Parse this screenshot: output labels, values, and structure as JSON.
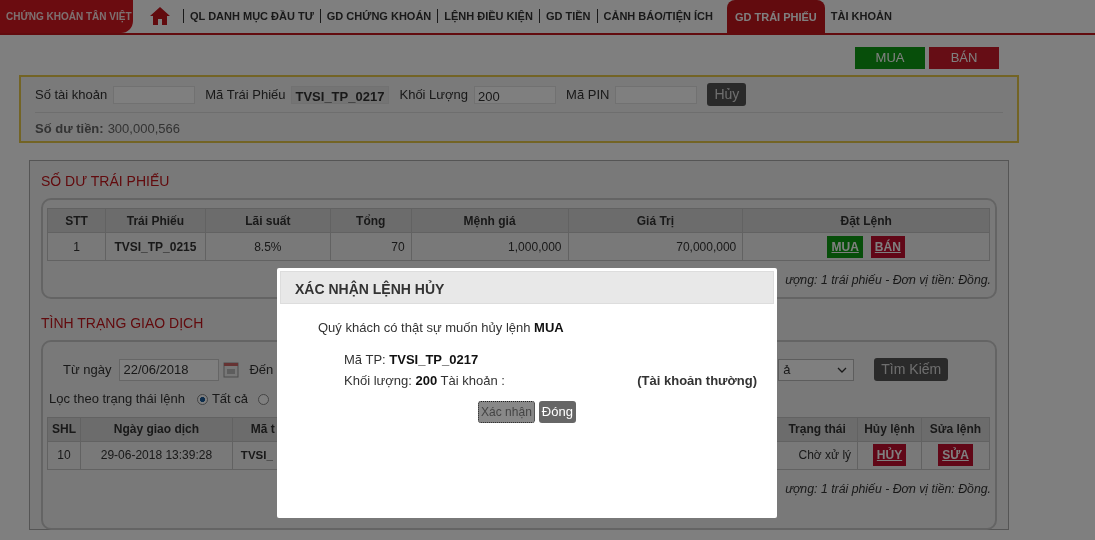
{
  "brand": {
    "text": "CHỨNG KHOÁN TÂN VIỆT"
  },
  "nav": [
    {
      "label": "QL DANH MỤC ĐẦU TƯ",
      "selected": false
    },
    {
      "label": "GD CHỨNG KHOÁN",
      "selected": false
    },
    {
      "label": "LỆNH ĐIỀU KIỆN",
      "selected": false
    },
    {
      "label": "GD TIỀN",
      "selected": false
    },
    {
      "label": "CẢNH BÁO/TIỆN ÍCH",
      "selected": false
    },
    {
      "label": "GD TRÁI PHIẾU",
      "selected": true
    },
    {
      "label": "TÀI KHOẢN",
      "selected": false
    }
  ],
  "order_buttons": [
    {
      "label": "MUA",
      "kind": "buy"
    },
    {
      "label": "BÁN",
      "kind": "sell"
    }
  ],
  "order_form": {
    "fields": [
      {
        "label": "Số tài khoản"
      },
      {
        "label": "Mã Trái Phiếu",
        "value": "TVSI_TP_0217",
        "kind": "readonly"
      },
      {
        "label": "Khối Lượng",
        "value": "200",
        "kind": "input"
      },
      {
        "label": "Mã PIN"
      }
    ],
    "cancel_button": "Hủy",
    "balance_label": "Số dư tiền:",
    "balance_value": "300,000,566"
  },
  "bond_balance": {
    "title": "SỐ DƯ TRÁI PHIẾU",
    "columns": [
      "STT",
      "Trái Phiếu",
      "Lãi suất",
      "Tổng",
      "Mệnh giá",
      "Giá Trị",
      "Đặt Lệnh"
    ],
    "rows": [
      {
        "cells": [
          "1",
          "TVSI_TP_0215",
          "8.5%",
          "70",
          "1,000,000",
          "70,000,000"
        ],
        "actions": [
          {
            "label": "MUA",
            "kind": "buy"
          },
          {
            "label": "BÁN",
            "kind": "sell"
          }
        ]
      }
    ],
    "note": "ượng: 1 trái phiếu - Đơn vị tiền: Đồng."
  },
  "transactions": {
    "title": "TÌNH TRẠNG GIAO DỊCH",
    "from_label": "Từ ngày",
    "from_value": "22/06/2018",
    "to_label": "Đến",
    "status_select": "ả",
    "search_button": "Tìm Kiếm",
    "filter_label": "Lọc theo trạng thái lệnh",
    "filter_options": [
      {
        "label": "Tất cả",
        "selected": true
      },
      {
        "selected": false
      }
    ],
    "columns": [
      "SHL",
      "Ngày giao dịch",
      "Mã t",
      "Trạng thái",
      "Hủy lệnh",
      "Sửa lệnh"
    ],
    "rows": [
      {
        "cells": [
          "10",
          "29-06-2018 13:39:28",
          "TVSI_",
          "Chờ xử lý"
        ],
        "actions": [
          {
            "label": "HỦY"
          },
          {
            "label": "SỬA"
          }
        ]
      }
    ],
    "note": "ượng: 1 trái phiếu - Đơn vị tiền: Đồng."
  },
  "dialog": {
    "title": "XÁC NHẬN LỆNH HỦY",
    "question": "Quý khách có thật sự muốn hủy lệnh **MUA**",
    "code_line": "Mã TP: **TVSI_TP_0217**",
    "volume_line": "Khối lượng: **200** Tài khoản :",
    "account_type": "(Tài khoản thường)",
    "buttons": [
      {
        "label": "Xác nhận",
        "kind": "confirm"
      },
      {
        "label": "Đóng",
        "kind": "close"
      }
    ]
  }
}
